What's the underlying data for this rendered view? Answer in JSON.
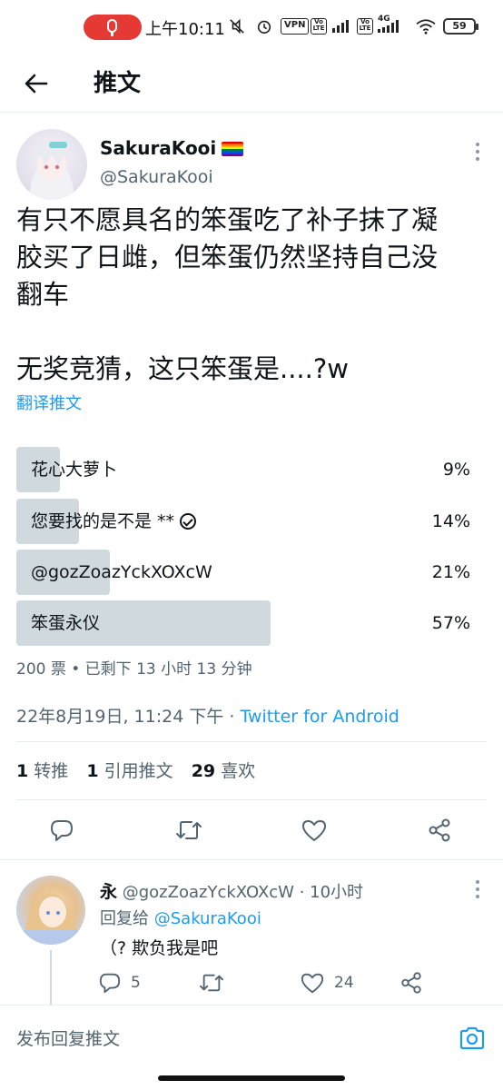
{
  "status_bar": {
    "time": "上午10:11",
    "vpn": "VPN",
    "volte1": "Vo LTE",
    "volte2": "Vo LTE",
    "network": "4G",
    "battery": "59"
  },
  "header": {
    "title": "推文"
  },
  "tweet": {
    "display_name": "SakuraKooi",
    "handle": "@SakuraKooi",
    "text_lines": [
      "有只不愿具名的笨蛋吃了补子抹了凝",
      "胶买了日雌，但笨蛋仍然坚持自己没",
      "翻车",
      "无奖竞猜，这只笨蛋是....?w"
    ],
    "translate": "翻译推文",
    "poll": {
      "options": [
        {
          "label": "花心大萝卜",
          "percent": "9%",
          "fraction": 0.09
        },
        {
          "label": "您要找的是不是 **",
          "percent": "14%",
          "fraction": 0.14
        },
        {
          "label": "@gozZoazYckXOXcW",
          "percent": "21%",
          "fraction": 0.21
        },
        {
          "label": "笨蛋永仪",
          "percent": "57%",
          "fraction": 0.57
        }
      ],
      "meta": "200 票 • 已剩下 13 小时 13 分钟"
    },
    "timestamp": "22年8月19日, 11:24 下午 · ",
    "source": "Twitter for Android",
    "stats": {
      "retweets": "1",
      "retweets_label": "转推",
      "quotes": "1",
      "quotes_label": "引用推文",
      "likes": "29",
      "likes_label": "喜欢"
    },
    "icons": {
      "reply": "reply-icon",
      "retweet": "retweet-icon",
      "like": "heart-icon",
      "share": "share-icon"
    }
  },
  "reply": {
    "name": "永",
    "handle_time": " @gozZoazYckXOXcW · 10小时",
    "reply_to_label": "回复给 ",
    "reply_to_handle": "@SakuraKooi",
    "text": "（? 欺负我是吧",
    "replies": "5",
    "likes": "24"
  },
  "compose": {
    "placeholder": "发布回复推文"
  },
  "colors": {
    "accent": "#1d9bf0",
    "poll_fill": "#cfd9de",
    "text": "#0f1419",
    "muted": "#536471"
  }
}
